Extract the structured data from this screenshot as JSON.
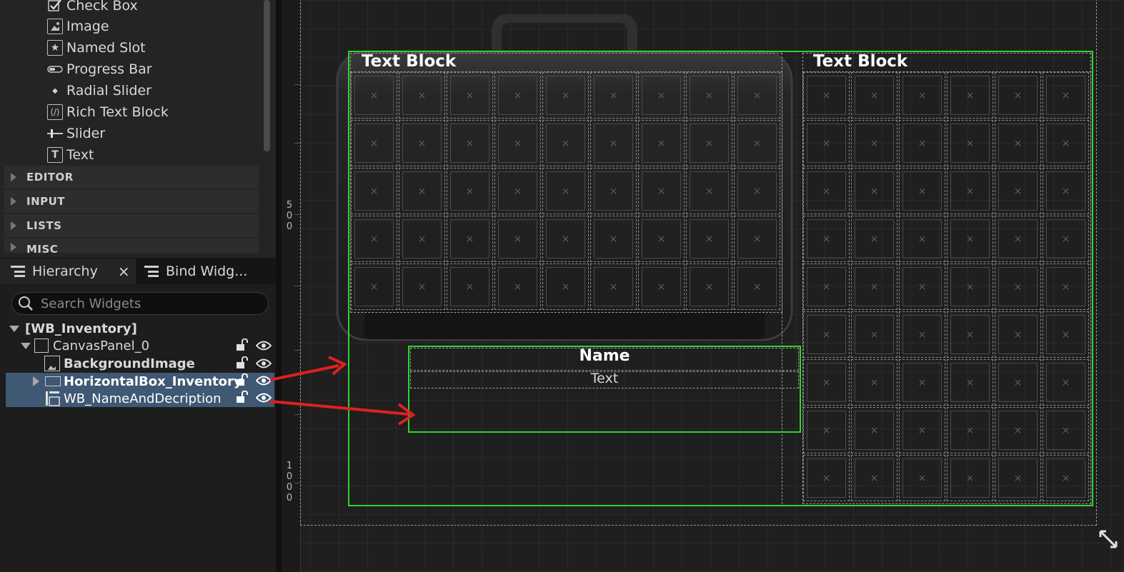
{
  "palette": {
    "items": [
      {
        "label": "Check Box",
        "icon": "check-box-icon"
      },
      {
        "label": "Image",
        "icon": "image-icon"
      },
      {
        "label": "Named Slot",
        "icon": "named-slot-icon"
      },
      {
        "label": "Progress Bar",
        "icon": "progress-bar-icon"
      },
      {
        "label": "Radial Slider",
        "icon": "radial-slider-icon"
      },
      {
        "label": "Rich Text Block",
        "icon": "rich-text-icon"
      },
      {
        "label": "Slider",
        "icon": "slider-icon"
      },
      {
        "label": "Text",
        "icon": "text-icon"
      }
    ],
    "categories": [
      "EDITOR",
      "INPUT",
      "LISTS",
      "MISC"
    ]
  },
  "tabs": {
    "hierarchy": "Hierarchy",
    "close": "×",
    "bind_widgets": "Bind Widg..."
  },
  "search": {
    "placeholder": "Search Widgets"
  },
  "tree": {
    "root": "[WB_Inventory]",
    "canvas_panel": "CanvasPanel_0",
    "background_image": "BackgroundImage",
    "horizontal_box": "HorizontalBox_Inventory",
    "name_and_description": "WB_NameAndDecription"
  },
  "canvas": {
    "left_text_block": "Text Block",
    "right_text_block": "Text Block",
    "name_title": "Name",
    "name_text": "Text",
    "ruler_500": [
      "5",
      "0",
      "0"
    ],
    "ruler_1000": [
      "1",
      "0",
      "0",
      "0"
    ]
  },
  "colors": {
    "selection": "#3f5873",
    "outline": "#2bd62b",
    "arrow": "#e02020"
  }
}
